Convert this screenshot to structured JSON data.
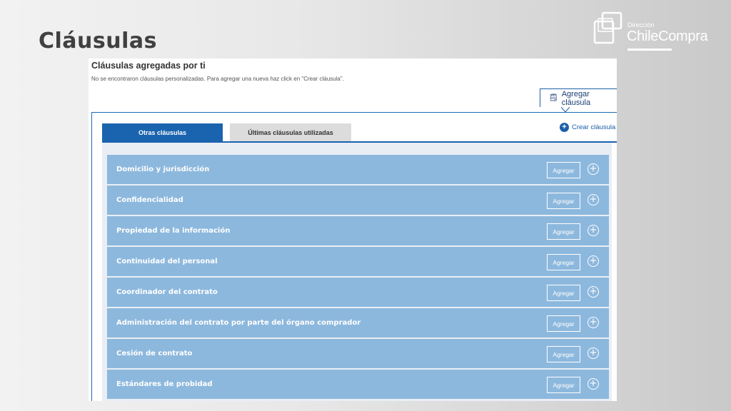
{
  "slide": {
    "title": "Cláusulas"
  },
  "logo": {
    "small_text": "Dirección",
    "big_text": "ChileCompra"
  },
  "panel": {
    "heading": "Cláusulas agregadas por ti",
    "note": "No se encontraron cláusulas personalizadas. Para agregar una nueva haz click en \"Crear cláusula\".",
    "add_clause_label": "Agregar cláusula",
    "create_clause_label": "Crear cláusula"
  },
  "tabs": [
    {
      "label": "Otras cláusulas",
      "active": true
    },
    {
      "label": "Últimas cláusulas utilizadas",
      "active": false
    }
  ],
  "clauses": [
    {
      "label": "Domicilio y jurisdicción",
      "button": "Agregar"
    },
    {
      "label": "Confidencialidad",
      "button": "Agregar"
    },
    {
      "label": "Propiedad de la información",
      "button": "Agregar"
    },
    {
      "label": "Continuidad del personal",
      "button": "Agregar"
    },
    {
      "label": "Coordinador del contrato",
      "button": "Agregar"
    },
    {
      "label": "Administración del contrato por parte del órgano comprador",
      "button": "Agregar"
    },
    {
      "label": "Cesión de contrato",
      "button": "Agregar"
    },
    {
      "label": "Estándares de probidad",
      "button": "Agregar"
    }
  ],
  "icons": {
    "add_clause": "document-edit-icon",
    "create": "plus-circle-icon",
    "row_expand": "plus-circle-outline-icon"
  },
  "colors": {
    "primary": "#1a63ae",
    "row": "#8db8dd",
    "tab_inactive": "#dcdcdc"
  }
}
